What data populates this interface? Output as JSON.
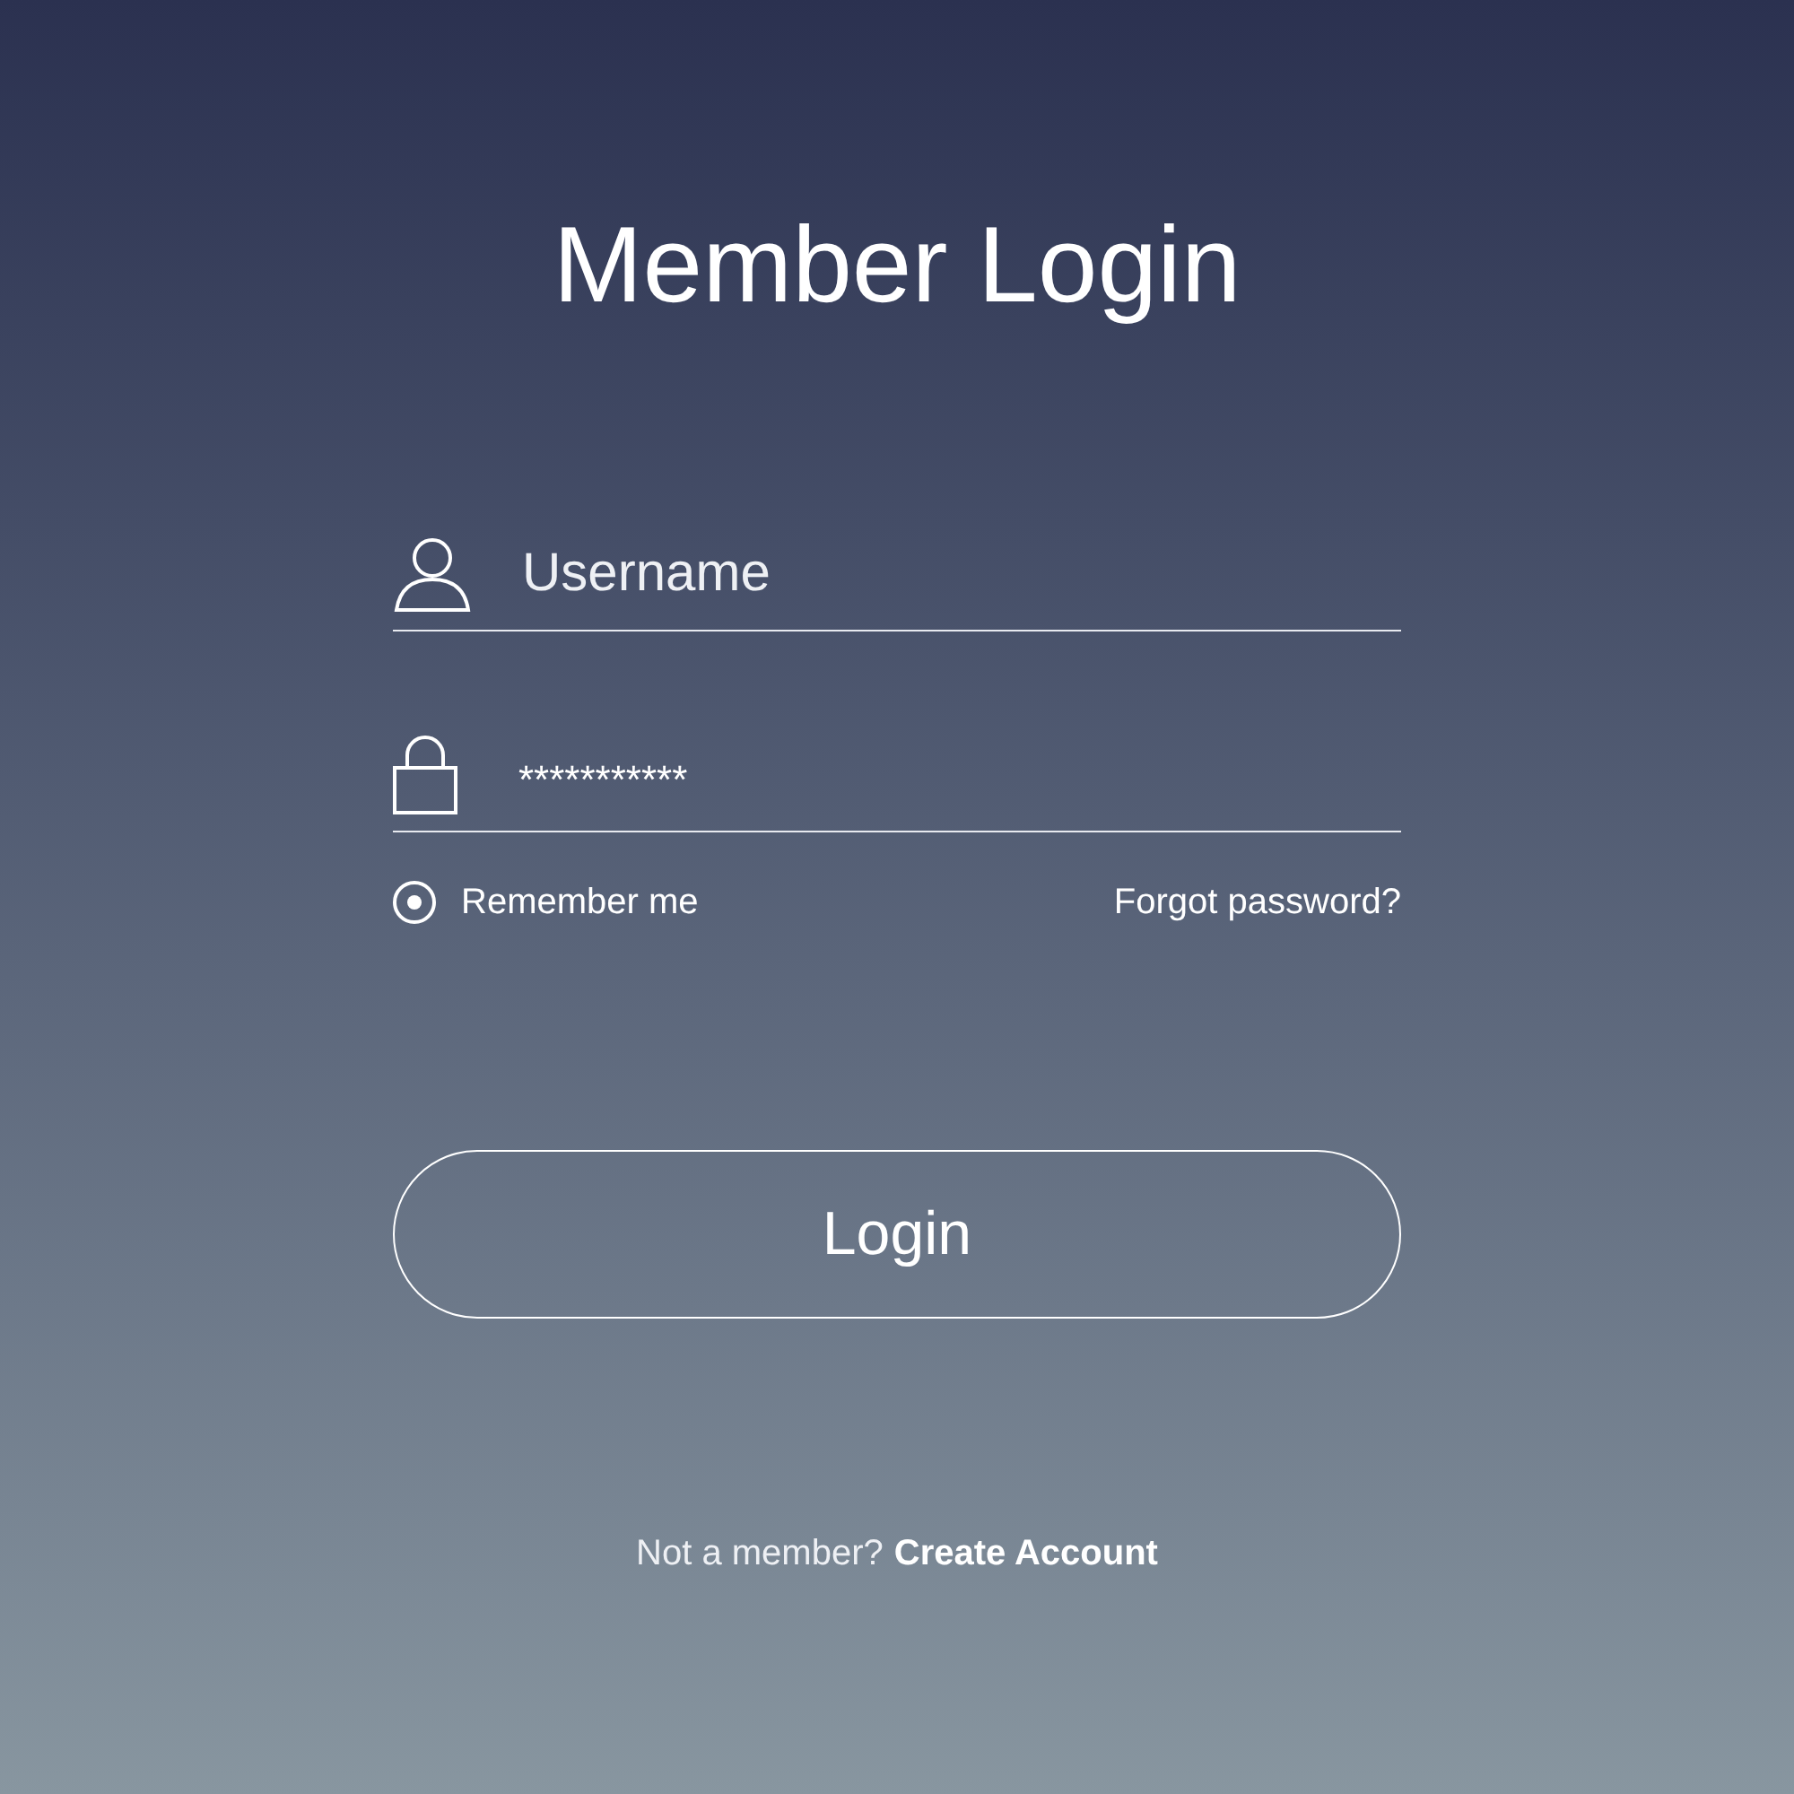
{
  "title": "Member Login",
  "username": {
    "placeholder": "Username"
  },
  "password": {
    "value": "***********"
  },
  "remember": {
    "label": "Remember me",
    "selected": true
  },
  "forgot_link": "Forgot password?",
  "login_button": "Login",
  "footer": {
    "prompt": "Not a member?",
    "link": "Create Account"
  }
}
